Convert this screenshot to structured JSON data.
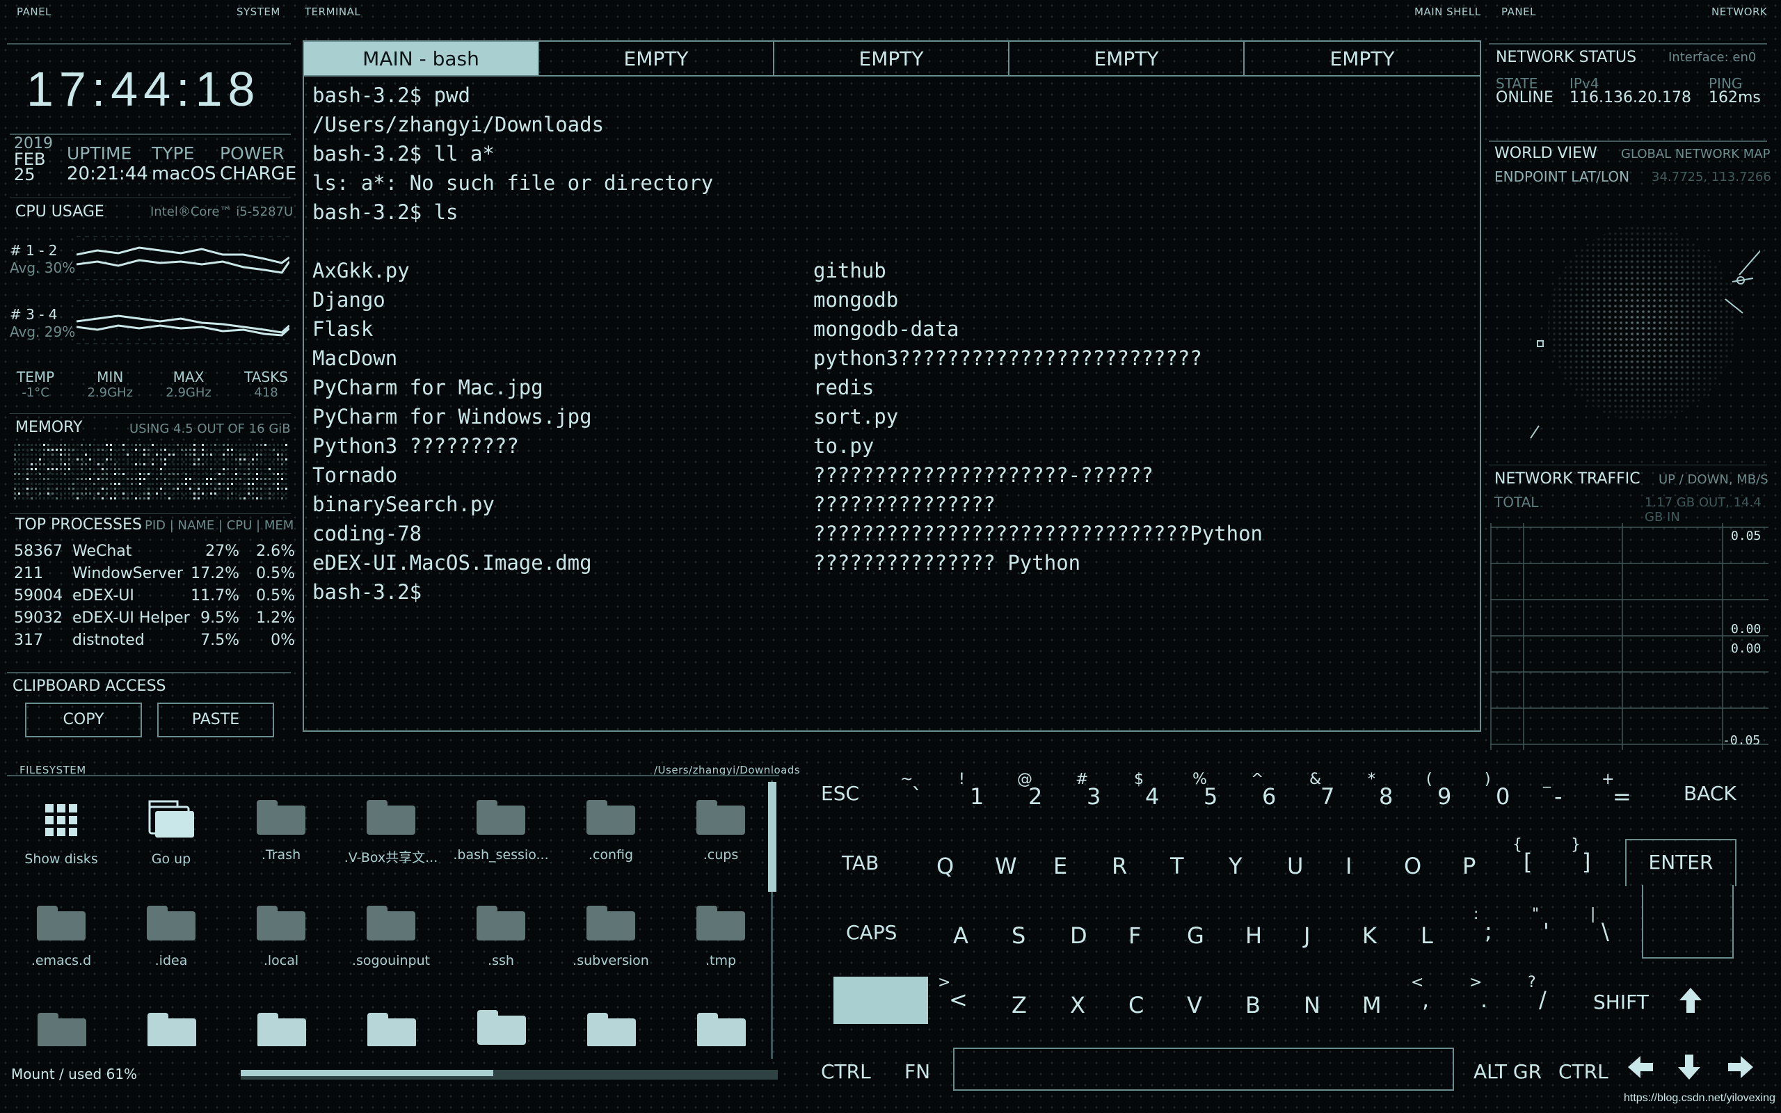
{
  "headers": {
    "left_panel": "PANEL",
    "left_system": "SYSTEM",
    "terminal": "TERMINAL",
    "main_shell": "MAIN SHELL",
    "right_panel": "PANEL",
    "right_network": "NETWORK",
    "filesystem": "FILESYSTEM",
    "fs_path": "/Users/zhangyi/Downloads"
  },
  "clock": {
    "time": "17:44:18"
  },
  "sysinfo": {
    "year": "2019",
    "month": "FEB",
    "day": "25",
    "uptime_label": "UPTIME",
    "uptime": "20:21:44",
    "type_label": "TYPE",
    "type": "macOS",
    "power_label": "POWER",
    "power": "CHARGE"
  },
  "cpu": {
    "title": "CPU USAGE",
    "model": "Intel®Core™ i5-5287U",
    "cores": [
      {
        "label": "# 1 - 2",
        "avg": "Avg. 30%"
      },
      {
        "label": "# 3 - 4",
        "avg": "Avg. 29%"
      }
    ],
    "stats": [
      {
        "label": "TEMP",
        "value": "-1°C"
      },
      {
        "label": "MIN",
        "value": "2.9GHz"
      },
      {
        "label": "MAX",
        "value": "2.9GHz"
      },
      {
        "label": "TASKS",
        "value": "418"
      }
    ]
  },
  "memory": {
    "title": "MEMORY",
    "usage": "USING 4.5 OUT OF 16 GiB"
  },
  "processes": {
    "title": "TOP PROCESSES",
    "columns": "PID | NAME | CPU | MEM",
    "rows": [
      {
        "pid": "58367",
        "name": "WeChat",
        "cpu": "27%",
        "mem": "2.6%"
      },
      {
        "pid": "211",
        "name": "WindowServer",
        "cpu": "17.2%",
        "mem": "0.5%"
      },
      {
        "pid": "59004",
        "name": "eDEX-UI",
        "cpu": "11.7%",
        "mem": "0.5%"
      },
      {
        "pid": "59032",
        "name": "eDEX-UI Helper",
        "cpu": "9.5%",
        "mem": "1.2%"
      },
      {
        "pid": "317",
        "name": "distnoted",
        "cpu": "7.5%",
        "mem": "0%"
      }
    ]
  },
  "clipboard": {
    "title": "CLIPBOARD ACCESS",
    "copy": "COPY",
    "paste": "PASTE"
  },
  "terminal": {
    "tabs": [
      "MAIN - bash",
      "EMPTY",
      "EMPTY",
      "EMPTY",
      "EMPTY"
    ],
    "lines": [
      "bash-3.2$ pwd",
      "/Users/zhangyi/Downloads",
      "bash-3.2$ ll a*",
      "ls: a*: No such file or directory",
      "bash-3.2$ ls"
    ],
    "ls_left": [
      "AxGkk.py",
      "Django",
      "Flask",
      "MacDown",
      "PyCharm for Mac.jpg",
      "PyCharm for Windows.jpg",
      "Python3 ?????????",
      "Tornado",
      "binarySearch.py",
      "coding-78",
      "eDEX-UI.MacOS.Image.dmg"
    ],
    "ls_right": [
      "github",
      "mongodb",
      "mongodb-data",
      "python3?????????????????????????",
      "redis",
      "sort.py",
      "to.py",
      "?????????????????????-??????",
      "???????????????",
      "???????????????????????????????Python",
      "??????????????? Python"
    ],
    "prompt": "bash-3.2$"
  },
  "network": {
    "status_title": "NETWORK STATUS",
    "interface": "Interface: en0",
    "state_label": "STATE",
    "state": "ONLINE",
    "ipv4_label": "IPv4",
    "ipv4": "116.136.20.178",
    "ping_label": "PING",
    "ping": "162ms",
    "world_title": "WORLD VIEW",
    "world_sub": "GLOBAL NETWORK MAP",
    "endpoint_label": "ENDPOINT LAT/LON",
    "endpoint": "34.7725, 113.7266",
    "traffic_title": "NETWORK TRAFFIC",
    "traffic_units": "UP / DOWN, MB/S",
    "total_label": "TOTAL",
    "total": "1.17 GB OUT, 14.4 GB IN",
    "chart_top_max": "0.05",
    "chart_top_min": "0.00",
    "chart_bot_max": "0.00",
    "chart_bot_min": "-0.05"
  },
  "filesystem": {
    "items": [
      {
        "name": "Show disks",
        "icon": "grid-icon"
      },
      {
        "name": "Go up",
        "icon": "go-up-icon"
      },
      {
        "name": ".Trash",
        "icon": "folder-icon"
      },
      {
        "name": ".V-Box共享文...",
        "icon": "folder-icon"
      },
      {
        "name": ".bash_sessio...",
        "icon": "folder-icon"
      },
      {
        "name": ".config",
        "icon": "folder-icon"
      },
      {
        "name": ".cups",
        "icon": "folder-icon"
      },
      {
        "name": ".emacs.d",
        "icon": "folder-icon"
      },
      {
        "name": ".idea",
        "icon": "folder-icon"
      },
      {
        "name": ".local",
        "icon": "folder-icon"
      },
      {
        "name": ".sogouinput",
        "icon": "folder-icon"
      },
      {
        "name": ".ssh",
        "icon": "folder-icon"
      },
      {
        "name": ".subversion",
        "icon": "folder-icon"
      },
      {
        "name": ".tmp",
        "icon": "folder-icon"
      }
    ],
    "mount": "Mount / used 61%",
    "used_fraction": 0.61
  },
  "keyboard": {
    "esc": "ESC",
    "back": "BACK",
    "tab": "TAB",
    "enter": "ENTER",
    "caps": "CAPS",
    "shift": "SHIFT",
    "ctrl": "CTRL",
    "fn": "FN",
    "altgr": "ALT GR",
    "row1": [
      [
        "~",
        "`"
      ],
      [
        "!",
        "1"
      ],
      [
        "@",
        "2"
      ],
      [
        "#",
        "3"
      ],
      [
        "$",
        "4"
      ],
      [
        "%",
        "5"
      ],
      [
        "^",
        "6"
      ],
      [
        "&",
        "7"
      ],
      [
        "*",
        "8"
      ],
      [
        "(",
        "9"
      ],
      [
        ")",
        "0"
      ],
      [
        "_",
        "-"
      ],
      [
        "+",
        "="
      ]
    ],
    "row2": [
      "Q",
      "W",
      "E",
      "R",
      "T",
      "Y",
      "U",
      "I",
      "O",
      "P"
    ],
    "row2b": [
      [
        "{",
        "["
      ],
      [
        "}",
        "]"
      ]
    ],
    "row3": [
      "A",
      "S",
      "D",
      "F",
      "G",
      "H",
      "J",
      "K",
      "L"
    ],
    "row3b": [
      [
        ":",
        ";"
      ],
      [
        "\"",
        "'"
      ],
      [
        "|",
        "\\"
      ]
    ],
    "row4a": [
      [
        ">",
        "<"
      ]
    ],
    "row4": [
      "Z",
      "X",
      "C",
      "V",
      "B",
      "N",
      "M"
    ],
    "row4b": [
      [
        "<",
        ","
      ],
      [
        ">",
        "."
      ],
      [
        "?",
        "/"
      ]
    ]
  },
  "watermark": "https://blog.csdn.net/yilovexing"
}
